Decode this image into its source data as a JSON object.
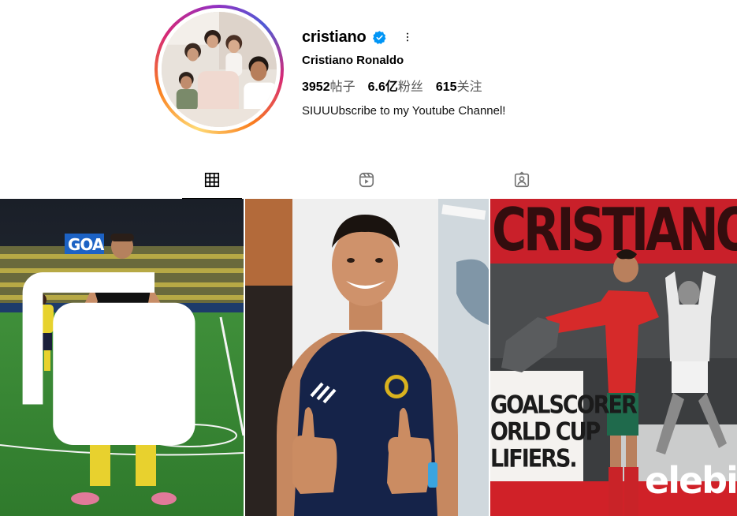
{
  "profile": {
    "username": "cristiano",
    "full_name": "Cristiano Ronaldo",
    "bio": "SIUUUbscribe to my Youtube Channel!",
    "verified": true,
    "stats": {
      "posts_count": "3952",
      "posts_label": "帖子",
      "followers_count": "6.6亿",
      "followers_label": "粉丝",
      "following_count": "615",
      "following_label": "关注"
    }
  },
  "icons": {
    "verified": "verified-badge-icon",
    "more": "more-options-icon",
    "posts_tab": "grid-icon",
    "reels_tab": "reels-icon",
    "tagged_tab": "tagged-icon",
    "carousel": "multiple-images-icon"
  },
  "tabs": {
    "active": "posts"
  },
  "posts": {
    "post1_banner": "GOA",
    "post3_top_text": "CRISTIANO",
    "post3_line1": "GOALSCORER",
    "post3_line2": "ORLD CUP",
    "post3_line3": "LIFIERS.",
    "post3_side_text": "elebi"
  },
  "colors": {
    "verified_blue": "#0095f6",
    "text_secondary": "#555555",
    "ring_start": "#feda75",
    "ring_end": "#d62976"
  }
}
